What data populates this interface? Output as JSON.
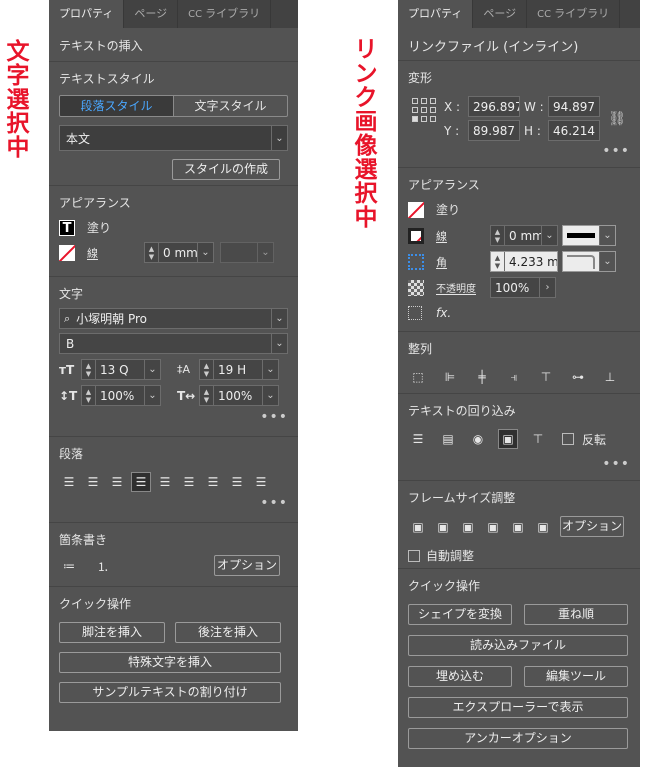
{
  "labels": {
    "left": "文字選択中",
    "right": "リンク画像選択中"
  },
  "left_panel": {
    "tabs": [
      "プロパティ",
      "ページ",
      "ライブラリ"
    ],
    "cc_prefix": "CC",
    "insert_text": "テキストの挿入",
    "text_style": {
      "title": "テキストスタイル",
      "seg_paragraph": "段落スタイル",
      "seg_char": "文字スタイル",
      "style_value": "本文",
      "create_button": "スタイルの作成"
    },
    "appearance": {
      "title": "アピアランス",
      "fill_label": "塗り",
      "stroke_label": "線",
      "stroke_weight": "0 mm"
    },
    "character": {
      "title": "文字",
      "font": "小塚明朝 Pro",
      "weight": "B",
      "size": "13 Q",
      "leading": "19 H",
      "vscale": "100%",
      "hscale": "100%"
    },
    "paragraph": {
      "title": "段落"
    },
    "bullets": {
      "title": "箇条書き",
      "options_button": "オプション"
    },
    "quick": {
      "title": "クイック操作",
      "footnote_button": "脚注を挿入",
      "endnote_button": "後注を挿入",
      "special_char_button": "特殊文字を挿入",
      "sample_text_button": "サンプルテキストの割り付け"
    }
  },
  "right_panel": {
    "tabs": [
      "プロパティ",
      "ページ",
      "ライブラリ"
    ],
    "cc_prefix": "CC",
    "link_title": "リンクファイル (インライン)",
    "transform": {
      "title": "変形",
      "x_label": "X :",
      "x_value": "296.897",
      "w_label": "W :",
      "w_value": "94.897 r",
      "y_label": "Y :",
      "y_value": "89.987 r",
      "h_label": "H :",
      "h_value": "46.214 r"
    },
    "appearance": {
      "title": "アピアランス",
      "fill_label": "塗り",
      "stroke_label": "線",
      "stroke_weight": "0 mm",
      "corner_label": "角",
      "corner_value": "4.233 m",
      "opacity_label": "不透明度",
      "opacity_value": "100%",
      "fx_label": "fx."
    },
    "align": {
      "title": "整列"
    },
    "wrap": {
      "title": "テキストの回り込み",
      "invert_label": "反転"
    },
    "frame_fit": {
      "title": "フレームサイズ調整",
      "options_button": "オプション",
      "auto_fit_label": "自動調整"
    },
    "quick": {
      "title": "クイック操作",
      "convert_shape_button": "シェイプを変換",
      "arrange_button": "重ね順",
      "relink_button": "読み込みファイル",
      "embed_button": "埋め込む",
      "edit_with_button": "編集ツール",
      "reveal_button": "エクスプローラーで表示",
      "anchor_button": "アンカーオプション"
    }
  }
}
